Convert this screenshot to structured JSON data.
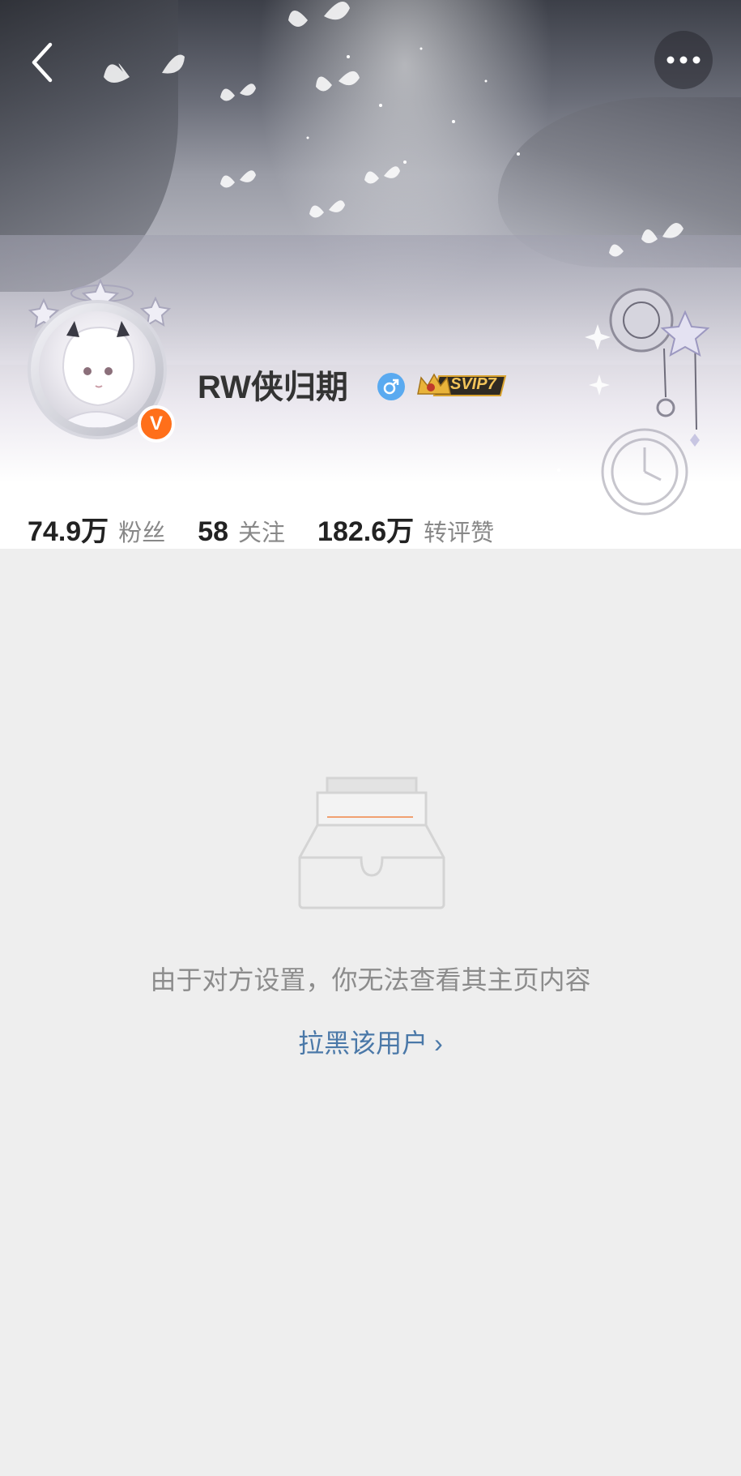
{
  "profile": {
    "username": "RW侠归期",
    "vip_label": "SVIP7",
    "verified_mark": "V"
  },
  "stats": [
    {
      "value": "74.9万",
      "label": "粉丝"
    },
    {
      "value": "58",
      "label": "关注"
    },
    {
      "value": "182.6万",
      "label": "转评赞"
    }
  ],
  "empty_state": {
    "message": "由于对方设置，你无法查看其主页内容",
    "block_link": "拉黑该用户",
    "block_chevron": "›"
  },
  "colors": {
    "background": "#eeeeee",
    "verified_badge": "#ff6f1a",
    "link": "#4a78a8",
    "gender_icon": "#5aaaf0",
    "vip_gold": "#d9a330"
  },
  "icons": {
    "back": "back-arrow-icon",
    "more": "more-dots-icon",
    "gender": "male-icon",
    "empty": "empty-inbox-icon"
  }
}
